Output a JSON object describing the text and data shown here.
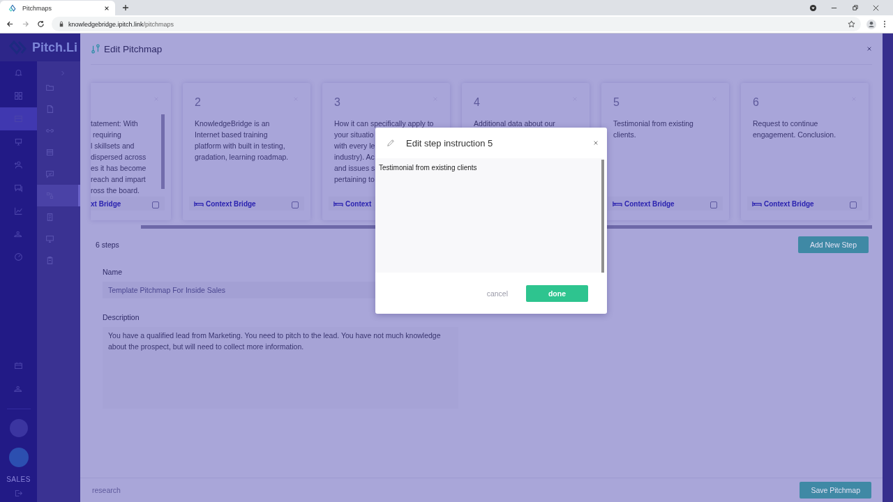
{
  "browser": {
    "tab": {
      "title": "Pitchmaps"
    },
    "url": {
      "host": "knowledgebridge.ipitch.link",
      "path": "/pitchmaps"
    }
  },
  "app": {
    "logo": "Pitch.Li",
    "sidebar_label": "SALES",
    "sidebar": {
      "items": [
        {
          "selected": false
        },
        {
          "selected": false
        },
        {
          "selected": true
        },
        {
          "selected": false
        },
        {
          "selected": false
        },
        {
          "selected": false
        },
        {
          "selected": false
        },
        {
          "selected": false
        },
        {
          "selected": false
        }
      ]
    },
    "subnav": {
      "items": [
        {
          "selected": false
        },
        {
          "selected": false
        },
        {
          "selected": false
        },
        {
          "selected": false
        },
        {
          "selected": false
        },
        {
          "selected": true
        },
        {
          "selected": false
        },
        {
          "selected": false
        },
        {
          "selected": false
        }
      ]
    }
  },
  "panel": {
    "title": "Edit Pitchmap",
    "steps": [
      {
        "lines": [
          "tatement: With",
          "requiring",
          "l skillsets and",
          "dispersed across",
          "es it has become",
          "reach and impart",
          "ross the board."
        ],
        "link": "xt Bridge",
        "checked": false
      },
      {
        "number": "2",
        "lines": [
          "KnowledgeBridge is an",
          "Internet based training",
          "platform with built in testing,",
          "gradation, learning roadmap."
        ],
        "link": "Context Bridge",
        "checked": false
      },
      {
        "number": "3",
        "lines": [
          "How it can specifically apply to",
          "your situatio",
          "with every le",
          "industry). Ac",
          "and issues s",
          "pertaining to"
        ],
        "link": "Context"
      },
      {
        "number": "4",
        "lines": [
          "Additional data about our"
        ]
      },
      {
        "number": "5",
        "lines": [
          "Testimonial from existing",
          "clients."
        ],
        "link": "Context Bridge",
        "checked": false
      },
      {
        "number": "6",
        "lines": [
          "Request to continue",
          "engagement. Conclusion."
        ],
        "link": "Context Bridge",
        "checked": false
      }
    ],
    "step_count": "6 steps",
    "add_button": "Add New Step",
    "name": {
      "label": "Name",
      "value": "Template Pitchmap For Inside Sales"
    },
    "description": {
      "label": "Description",
      "value": "You have a qualified lead from Marketing. You need to pitch to the lead. You have not much knowledge\nabout the prospect, but will need to collect more information."
    },
    "search": {
      "placeholder": "research"
    },
    "save_button": "Save Pitchmap"
  },
  "dialog": {
    "title": "Edit step instruction 5",
    "value": "Testimonial from existing clients",
    "cancel": "cancel",
    "done": "done"
  }
}
